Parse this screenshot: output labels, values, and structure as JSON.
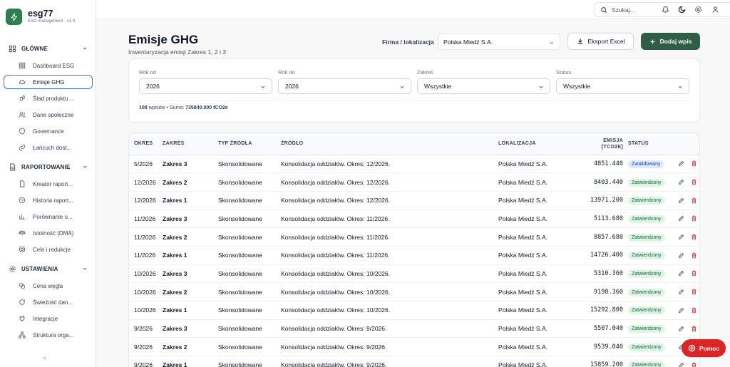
{
  "brand": {
    "name": "esg77",
    "subtitle": "ESG management · v1.0"
  },
  "nav": {
    "sections": [
      {
        "label": "GŁÓWNE",
        "items": [
          "Dashboard ESG",
          "Emisje GHG",
          "Ślad produktu ...",
          "Dane społeczne",
          "Governance",
          "Łańcuch dost..."
        ]
      },
      {
        "label": "RAPORTOWANIE",
        "items": [
          "Kreator raport...",
          "Historia raport...",
          "Porównanie o...",
          "Istotność (DMA)",
          "Cele i redukcje"
        ]
      },
      {
        "label": "USTAWIENIA",
        "items": [
          "Cena węgla",
          "Świeżość dan...",
          "Integracje",
          "Struktura orga..."
        ]
      }
    ],
    "collapse_label": "«"
  },
  "topbar": {
    "search_placeholder": "Szukaj...",
    "search_shortcut": "⌘K"
  },
  "page": {
    "title": "Emisje GHG",
    "subtitle": "Inwentaryzacja emisji Zakres 1, 2 i 3"
  },
  "firm": {
    "label": "Firma / lokalizacja",
    "value": "Polska Miedź S.A."
  },
  "actions": {
    "export": "Eksport Excel",
    "add": "Dodaj wpis"
  },
  "filters": {
    "year_from": {
      "label": "Rok od",
      "value": "2026"
    },
    "year_to": {
      "label": "Rok do",
      "value": "2026"
    },
    "scope": {
      "label": "Zakres",
      "value": "Wszystkie"
    },
    "status": {
      "label": "Status",
      "value": "Wszystkie"
    }
  },
  "summary": {
    "count": "108",
    "count_label": "wpisów",
    "sep": "•",
    "sum_label": "Suma:",
    "sum_value": "735840.000 tCO2e"
  },
  "table": {
    "headers": {
      "period": "OKRES",
      "scope": "ZAKRES",
      "source_type": "TYP ŹRÓDŁA",
      "source": "ŹRÓDŁO",
      "location": "LOKALIZACJA",
      "emission": "EMISJA",
      "emission_unit": "[TCO2E]",
      "status": "STATUS"
    },
    "rows": [
      {
        "period": "5/2026",
        "scope": "Zakres 3",
        "type": "Skonsolidowane",
        "source": "Konsolidacja oddziałów. Okres: 12/2026.",
        "location": "Polska Miedź S.A.",
        "emission": "4851.440",
        "status": "Zwalidowany"
      },
      {
        "period": "12/2026",
        "scope": "Zakres 2",
        "type": "Skonsolidowane",
        "source": "Konsolidacja oddziałów. Okres: 12/2026.",
        "location": "Polska Miedź S.A.",
        "emission": "8403.440",
        "status": "Zatwierdzony"
      },
      {
        "period": "12/2026",
        "scope": "Zakres 1",
        "type": "Skonsolidowane",
        "source": "Konsolidacja oddziałów. Okres: 12/2026.",
        "location": "Polska Miedź S.A.",
        "emission": "13971.200",
        "status": "Zatwierdzony"
      },
      {
        "period": "11/2026",
        "scope": "Zakres 3",
        "type": "Skonsolidowane",
        "source": "Konsolidacja oddziałów. Okres: 11/2026.",
        "location": "Polska Miedź S.A.",
        "emission": "5113.680",
        "status": "Zatwierdzony"
      },
      {
        "period": "11/2026",
        "scope": "Zakres 2",
        "type": "Skonsolidowane",
        "source": "Konsolidacja oddziałów. Okres: 11/2026.",
        "location": "Polska Miedź S.A.",
        "emission": "8857.680",
        "status": "Zatwierdzony"
      },
      {
        "period": "11/2026",
        "scope": "Zakres 1",
        "type": "Skonsolidowane",
        "source": "Konsolidacja oddziałów. Okres: 11/2026.",
        "location": "Polska Miedź S.A.",
        "emission": "14726.400",
        "status": "Zatwierdzony"
      },
      {
        "period": "10/2026",
        "scope": "Zakres 3",
        "type": "Skonsolidowane",
        "source": "Konsolidacja oddziałów. Okres: 10/2026.",
        "location": "Polska Miedź S.A.",
        "emission": "5310.360",
        "status": "Zatwierdzony"
      },
      {
        "period": "10/2026",
        "scope": "Zakres 2",
        "type": "Skonsolidowane",
        "source": "Konsolidacja oddziałów. Okres: 10/2026.",
        "location": "Polska Miedź S.A.",
        "emission": "9198.360",
        "status": "Zatwierdzony"
      },
      {
        "period": "10/2026",
        "scope": "Zakres 1",
        "type": "Skonsolidowane",
        "source": "Konsolidacja oddziałów. Okres: 10/2026.",
        "location": "Polska Miedź S.A.",
        "emission": "15292.800",
        "status": "Zatwierdzony"
      },
      {
        "period": "9/2026",
        "scope": "Zakres 3",
        "type": "Skonsolidowane",
        "source": "Konsolidacja oddziałów. Okres: 9/2026.",
        "location": "Polska Miedź S.A.",
        "emission": "5507.040",
        "status": "Zatwierdzony"
      },
      {
        "period": "9/2026",
        "scope": "Zakres 2",
        "type": "Skonsolidowane",
        "source": "Konsolidacja oddziałów. Okres: 9/2026.",
        "location": "Polska Miedź S.A.",
        "emission": "9539.040",
        "status": "Zatwierdzony"
      },
      {
        "period": "9/2026",
        "scope": "Zakres 1",
        "type": "Skonsolidowane",
        "source": "Konsolidacja oddziałów. Okres: 9/2026.",
        "location": "Polska Miedź S.A.",
        "emission": "15859.200",
        "status": "Zatwierdzony"
      }
    ]
  },
  "help": {
    "label": "Pomoc"
  },
  "colors": {
    "brand": "#2e7d4f",
    "primary_button": "#2e5e44",
    "help": "#dc2626",
    "active_border": "#3b6fd4",
    "delete": "#dc2626"
  }
}
